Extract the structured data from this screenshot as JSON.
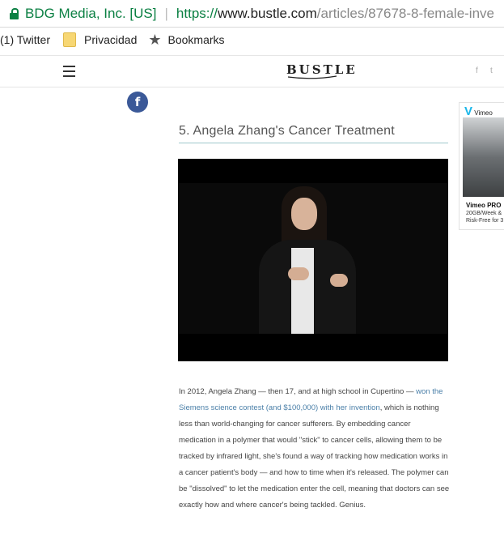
{
  "browser": {
    "org": "BDG Media, Inc. [US]",
    "url_proto": "https://",
    "url_host": "www.bustle.com",
    "url_path": "/articles/87678-8-female-inve"
  },
  "bookmarks": [
    {
      "label": "(1) Twitter"
    },
    {
      "label": "Privacidad"
    },
    {
      "label": "Bookmarks"
    }
  ],
  "site": {
    "logo": "BUSTLE",
    "social_fb": "f",
    "social_tw": "t"
  },
  "share": {
    "fb_label": "f"
  },
  "article": {
    "title": "5. Angela Zhang's Cancer Treatment",
    "para_start": "In 2012, Angela Zhang — then 17, and at high school in Cupertino — ",
    "para_link": "won the Siemens science contest (and $100,000) with her invention",
    "para_end": ", which is nothing less than world-changing for cancer sufferers. By embedding cancer medication in a polymer that would \"stick\" to cancer cells, allowing them to be tracked by infrared light, she's found a way of tracking how medication works in a cancer patient's body — and how to time when it's released. The polymer can be \"dissolved\" to let the medication enter the cell, meaning that doctors can see exactly how and where cancer's being tackled. Genius."
  },
  "ad": {
    "brand_icon": "V",
    "brand": "Vimeo",
    "title": "Vimeo PRO",
    "line1": "20GB/Week &",
    "line2": "Risk-Free for 3"
  },
  "colors": {
    "secure_green": "#0b8043",
    "facebook_blue": "#3b5998",
    "link_blue": "#4a7fa8",
    "title_rule": "#9fc8cc"
  }
}
